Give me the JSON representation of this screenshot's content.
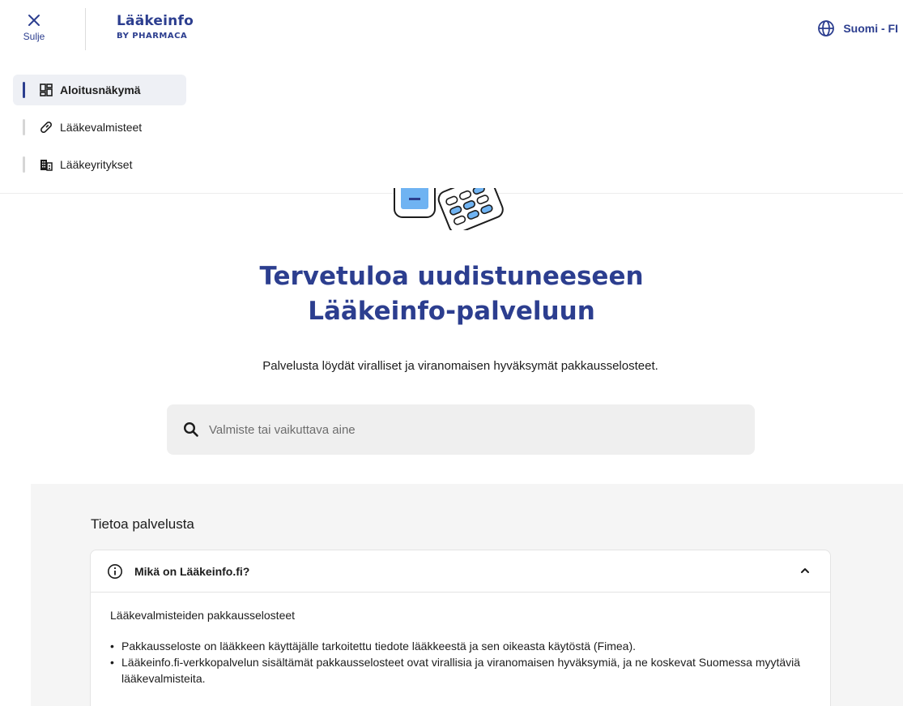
{
  "header": {
    "close_label": "Sulje",
    "logo_name": "Lääkeinfo",
    "logo_sub": "BY PHARMACA",
    "language": "Suomi - FI"
  },
  "nav": {
    "items": [
      {
        "label": "Aloitusnäkymä",
        "icon": "dashboard-icon",
        "active": true
      },
      {
        "label": "Lääkevalmisteet",
        "icon": "pill-icon",
        "active": false
      },
      {
        "label": "Lääkeyritykset",
        "icon": "building-icon",
        "active": false
      }
    ]
  },
  "hero": {
    "title_line1": "Tervetuloa uudistuneeseen",
    "title_line2": "Lääkeinfo-palveluun",
    "subtitle": "Palvelusta löydät viralliset ja viranomaisen hyväksymät pakkausselosteet."
  },
  "search": {
    "placeholder": "Valmiste tai vaikuttava aine",
    "value": ""
  },
  "info": {
    "heading": "Tietoa palvelusta",
    "accordion": {
      "title": "Mikä on Lääkeinfo.fi?",
      "expanded": true,
      "subtitle": "Lääkevalmisteiden pakkausselosteet",
      "items": [
        "Pakkausseloste on lääkkeen käyttäjälle tarkoitettu tiedote lääkkeestä ja sen oikeasta käytöstä (Fimea).",
        "Lääkeinfo.fi-verkkopalvelun sisältämät pakkausselosteet ovat virallisia ja viranomaisen hyväksymiä, ja ne koskevat Suomessa myytäviä lääkevalmisteita."
      ]
    }
  },
  "colors": {
    "brand": "#2c3e8f",
    "active_nav_bg": "#eef0f5",
    "section_bg": "#f5f5f5",
    "search_bg": "#efefef"
  }
}
